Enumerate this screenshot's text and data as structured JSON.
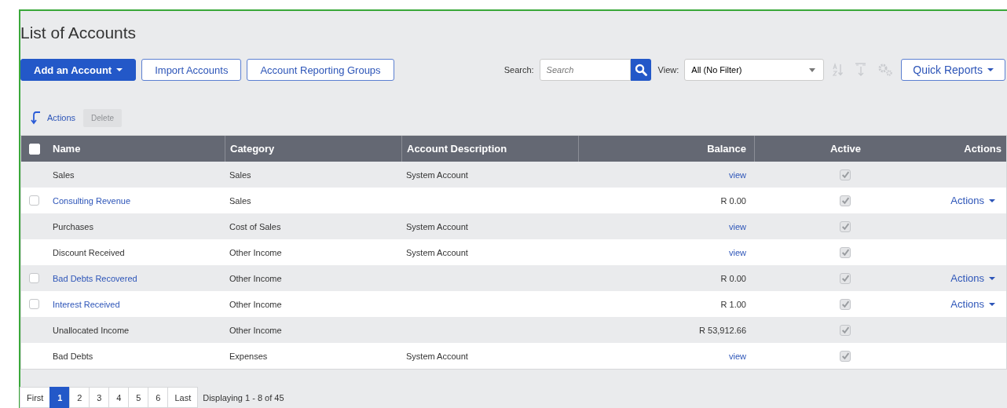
{
  "title": "List of Accounts",
  "toolbar": {
    "buttons": [
      {
        "label": "Add an Account",
        "kind": "primary",
        "caret": true
      },
      {
        "label": "Import Accounts",
        "kind": "outline",
        "caret": false
      },
      {
        "label": "Account Reporting Groups",
        "kind": "outline",
        "caret": false
      }
    ],
    "search_label": "Search:",
    "search": {
      "placeholder": "Search"
    },
    "view_label": "View:",
    "view": {
      "value": "All (No Filter)"
    },
    "quick_reports": "Quick Reports"
  },
  "bulk": {
    "actions": "Actions",
    "delete": {
      "label": "Delete",
      "disabled": true
    }
  },
  "table": {
    "columns": [
      "Name",
      "Category",
      "Account Description",
      "Balance",
      "Active",
      "Actions"
    ],
    "select_all": false,
    "rows": [
      {
        "kind": "fixed",
        "name": "Sales",
        "category": "Sales",
        "description": "System Account",
        "balance": "view",
        "balance_link": true,
        "active": true
      },
      {
        "kind": "editable",
        "checked": false,
        "name": "Consulting Revenue",
        "category": "Sales",
        "balance": "R 0.00",
        "balance_link": false,
        "active": true,
        "actions": "Actions"
      },
      {
        "kind": "fixed",
        "name": "Purchases",
        "category": "Cost of Sales",
        "description": "System Account",
        "balance": "view",
        "balance_link": true,
        "active": true
      },
      {
        "kind": "fixed",
        "name": "Discount Received",
        "category": "Other Income",
        "description": "System Account",
        "balance": "view",
        "balance_link": true,
        "active": true
      },
      {
        "kind": "editable",
        "checked": false,
        "name": "Bad Debts Recovered",
        "category": "Other Income",
        "balance": "R 0.00",
        "balance_link": false,
        "active": true,
        "actions": "Actions"
      },
      {
        "kind": "editable",
        "checked": false,
        "name": "Interest Received",
        "category": "Other Income",
        "balance": "R 1.00",
        "balance_link": false,
        "active": true,
        "actions": "Actions"
      },
      {
        "kind": "fixed",
        "name": "Unallocated Income",
        "category": "Other Income",
        "balance": "R 53,912.66",
        "balance_link": false,
        "active": true
      },
      {
        "kind": "fixed",
        "name": "Bad Debts",
        "category": "Expenses",
        "description": "System Account",
        "balance": "view",
        "balance_link": true,
        "active": true
      }
    ]
  },
  "pagination": {
    "pages": [
      {
        "label": "First",
        "selected": false
      },
      {
        "label": "1",
        "selected": true
      },
      {
        "label": "2",
        "selected": false
      },
      {
        "label": "3",
        "selected": false
      },
      {
        "label": "4",
        "selected": false
      },
      {
        "label": "5",
        "selected": false
      },
      {
        "label": "6",
        "selected": false
      },
      {
        "label": "Last",
        "selected": false
      }
    ],
    "summary": "Displaying 1 - 8 of 45"
  }
}
